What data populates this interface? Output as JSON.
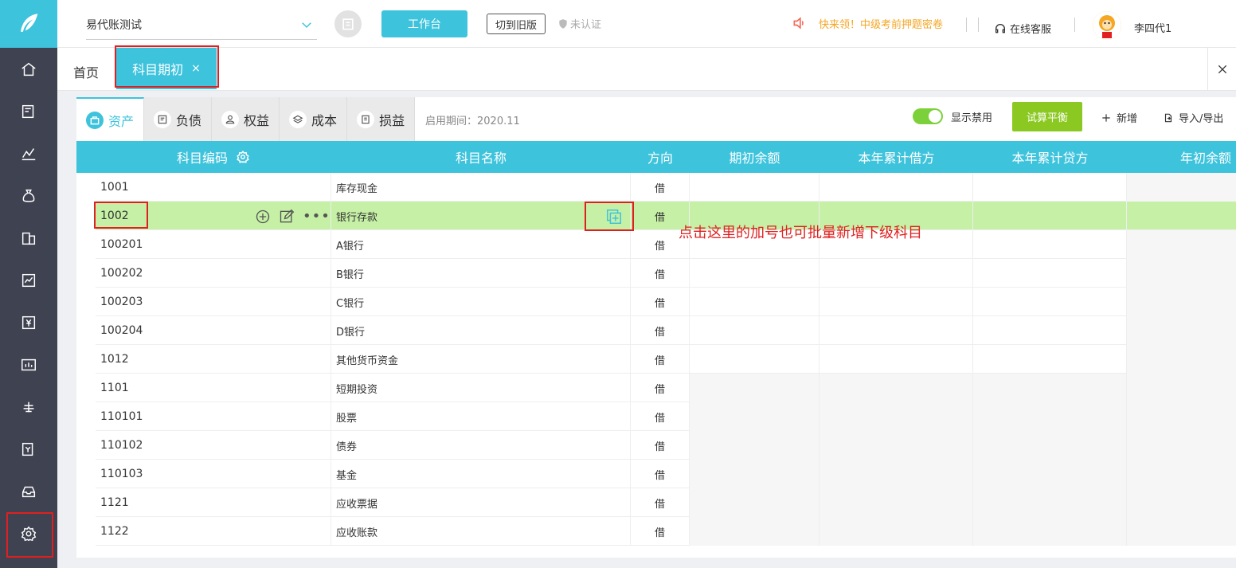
{
  "header": {
    "company": "易代账测试",
    "workbench": "工作台",
    "switch_old": "切到旧版",
    "unverified": "未认证",
    "promo": "快来领！中级考前押题密卷",
    "support": "在线客服",
    "username": "李四代1"
  },
  "tabs": {
    "home": "首页",
    "active": "科目期初",
    "close": "×"
  },
  "categories": [
    {
      "label": "资产",
      "icon": "asset-icon"
    },
    {
      "label": "负债",
      "icon": "liability-icon"
    },
    {
      "label": "权益",
      "icon": "equity-icon"
    },
    {
      "label": "成本",
      "icon": "cost-icon"
    },
    {
      "label": "损益",
      "icon": "profit-loss-icon"
    }
  ],
  "toolbar": {
    "period": "启用期间：2020.11",
    "show_disabled": "显示禁用",
    "trial_balance": "试算平衡",
    "add": "新增",
    "import_export": "导入/导出"
  },
  "columns": {
    "code": "科目编码",
    "name": "科目名称",
    "direction": "方向",
    "opening": "期初余额",
    "year_debit": "本年累计借方",
    "year_credit": "本年累计贷方",
    "year_opening": "年初余额"
  },
  "rows": [
    {
      "code": "1001",
      "name": "库存现金",
      "dir": "借"
    },
    {
      "code": "1002",
      "name": "银行存款",
      "dir": "借"
    },
    {
      "code": "100201",
      "name": "A银行",
      "dir": "借"
    },
    {
      "code": "100202",
      "name": "B银行",
      "dir": "借"
    },
    {
      "code": "100203",
      "name": "C银行",
      "dir": "借"
    },
    {
      "code": "100204",
      "name": "D银行",
      "dir": "借"
    },
    {
      "code": "1012",
      "name": "其他货币资金",
      "dir": "借"
    },
    {
      "code": "1101",
      "name": "短期投资",
      "dir": "借"
    },
    {
      "code": "110101",
      "name": "股票",
      "dir": "借"
    },
    {
      "code": "110102",
      "name": "债券",
      "dir": "借"
    },
    {
      "code": "110103",
      "name": "基金",
      "dir": "借"
    },
    {
      "code": "1121",
      "name": "应收票据",
      "dir": "借"
    },
    {
      "code": "1122",
      "name": "应收账款",
      "dir": "借"
    }
  ],
  "annotation": "点击这里的加号也可批量新增下级科目",
  "colors": {
    "accent": "#3ec3dc",
    "highlight": "#c5f0a5",
    "annotation": "#e02020",
    "trial": "#8bc922"
  }
}
